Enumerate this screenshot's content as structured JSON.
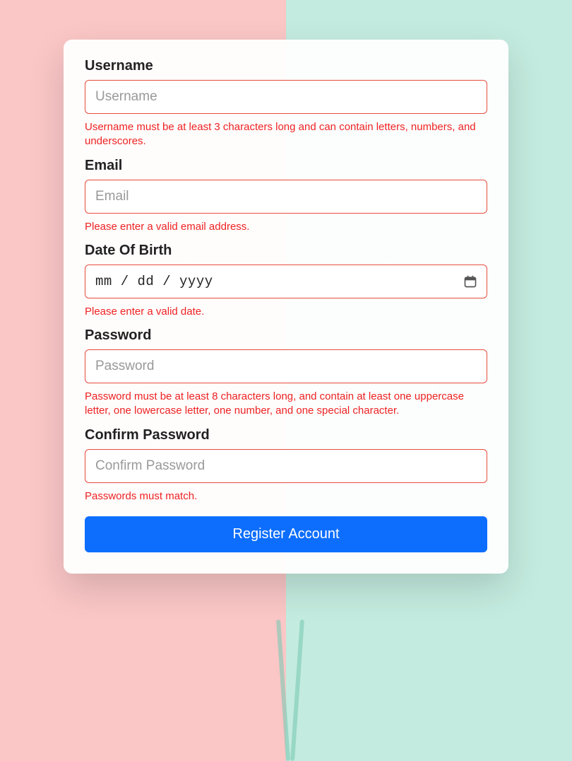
{
  "username": {
    "label": "Username",
    "placeholder": "Username",
    "error": "Username must be at least 3 characters long and can contain letters, numbers, and underscores."
  },
  "email": {
    "label": "Email",
    "placeholder": "Email",
    "error": "Please enter a valid email address."
  },
  "dob": {
    "label": "Date Of Birth",
    "placeholder": "mm / dd / yyyy",
    "error": "Please enter a valid date."
  },
  "password": {
    "label": "Password",
    "placeholder": "Password",
    "error": "Password must be at least 8 characters long, and contain at least one uppercase letter, one lowercase letter, one number, and one special character."
  },
  "confirm": {
    "label": "Confirm Password",
    "placeholder": "Confirm Password",
    "error": "Passwords must match."
  },
  "submit_label": "Register Account"
}
